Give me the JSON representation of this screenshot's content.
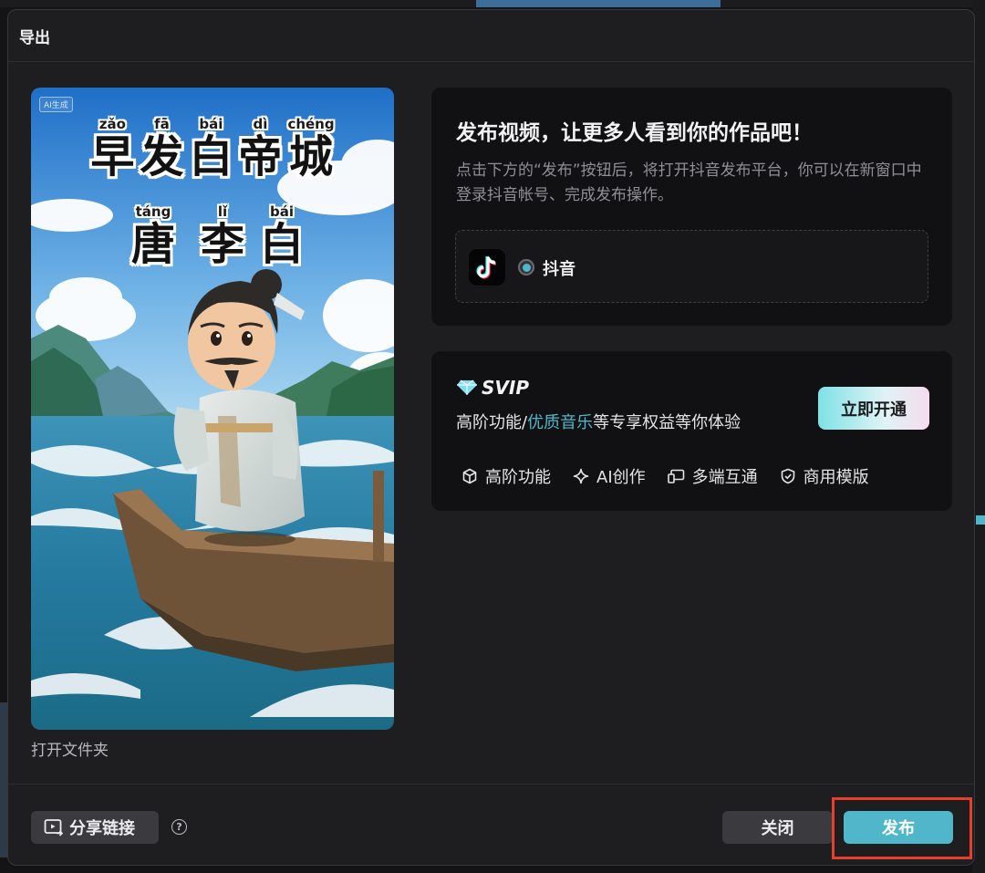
{
  "dialog": {
    "title": "导出"
  },
  "preview": {
    "ai_badge": "AI生成",
    "title_chars": [
      {
        "pinyin": "zǎo",
        "char": "早"
      },
      {
        "pinyin": "fā",
        "char": "发"
      },
      {
        "pinyin": "bái",
        "char": "白"
      },
      {
        "pinyin": "dì",
        "char": "帝"
      },
      {
        "pinyin": "chéng",
        "char": "城"
      }
    ],
    "author_chars": [
      {
        "pinyin": "táng",
        "char": "唐"
      },
      {
        "pinyin": "lǐ",
        "char": "李"
      },
      {
        "pinyin": "bái",
        "char": "白"
      }
    ],
    "open_folder_label": "打开文件夹"
  },
  "publish": {
    "title": "发布视频，让更多人看到你的作品吧！",
    "description": "点击下方的“发布”按钮后，将打开抖音发布平台，你可以在新窗口中登录抖音帐号、完成发布操作。",
    "platform": {
      "name": "抖音",
      "selected": true,
      "icon": "tiktok-icon"
    }
  },
  "svip": {
    "badge": "SVIP",
    "desc_prefix": "高阶功能/",
    "desc_highlight": "优质音乐",
    "desc_suffix": "等专享权益等你体验",
    "open_button": "立即开通",
    "features": [
      {
        "icon": "cube-icon",
        "label": "高阶功能"
      },
      {
        "icon": "sparkle-icon",
        "label": "AI创作"
      },
      {
        "icon": "devices-icon",
        "label": "多端互通"
      },
      {
        "icon": "shield-check-icon",
        "label": "商用模版"
      }
    ]
  },
  "footer": {
    "share_label": "分享链接",
    "help": "?",
    "close_label": "关闭",
    "publish_label": "发布"
  },
  "colors": {
    "accent": "#4fb7c9",
    "dialog_bg": "#1e1e21",
    "card_bg": "#111113",
    "highlight": "#e4402c"
  }
}
